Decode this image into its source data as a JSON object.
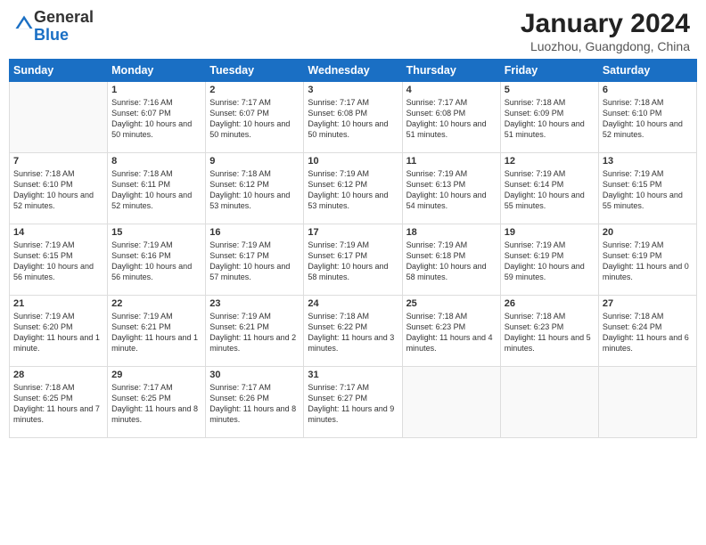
{
  "logo": {
    "general": "General",
    "blue": "Blue"
  },
  "title": "January 2024",
  "subtitle": "Luozhou, Guangdong, China",
  "days_of_week": [
    "Sunday",
    "Monday",
    "Tuesday",
    "Wednesday",
    "Thursday",
    "Friday",
    "Saturday"
  ],
  "weeks": [
    [
      {
        "num": "",
        "info": ""
      },
      {
        "num": "1",
        "info": "Sunrise: 7:16 AM\nSunset: 6:07 PM\nDaylight: 10 hours\nand 50 minutes."
      },
      {
        "num": "2",
        "info": "Sunrise: 7:17 AM\nSunset: 6:07 PM\nDaylight: 10 hours\nand 50 minutes."
      },
      {
        "num": "3",
        "info": "Sunrise: 7:17 AM\nSunset: 6:08 PM\nDaylight: 10 hours\nand 50 minutes."
      },
      {
        "num": "4",
        "info": "Sunrise: 7:17 AM\nSunset: 6:08 PM\nDaylight: 10 hours\nand 51 minutes."
      },
      {
        "num": "5",
        "info": "Sunrise: 7:18 AM\nSunset: 6:09 PM\nDaylight: 10 hours\nand 51 minutes."
      },
      {
        "num": "6",
        "info": "Sunrise: 7:18 AM\nSunset: 6:10 PM\nDaylight: 10 hours\nand 52 minutes."
      }
    ],
    [
      {
        "num": "7",
        "info": "Sunrise: 7:18 AM\nSunset: 6:10 PM\nDaylight: 10 hours\nand 52 minutes."
      },
      {
        "num": "8",
        "info": "Sunrise: 7:18 AM\nSunset: 6:11 PM\nDaylight: 10 hours\nand 52 minutes."
      },
      {
        "num": "9",
        "info": "Sunrise: 7:18 AM\nSunset: 6:12 PM\nDaylight: 10 hours\nand 53 minutes."
      },
      {
        "num": "10",
        "info": "Sunrise: 7:19 AM\nSunset: 6:12 PM\nDaylight: 10 hours\nand 53 minutes."
      },
      {
        "num": "11",
        "info": "Sunrise: 7:19 AM\nSunset: 6:13 PM\nDaylight: 10 hours\nand 54 minutes."
      },
      {
        "num": "12",
        "info": "Sunrise: 7:19 AM\nSunset: 6:14 PM\nDaylight: 10 hours\nand 55 minutes."
      },
      {
        "num": "13",
        "info": "Sunrise: 7:19 AM\nSunset: 6:15 PM\nDaylight: 10 hours\nand 55 minutes."
      }
    ],
    [
      {
        "num": "14",
        "info": "Sunrise: 7:19 AM\nSunset: 6:15 PM\nDaylight: 10 hours\nand 56 minutes."
      },
      {
        "num": "15",
        "info": "Sunrise: 7:19 AM\nSunset: 6:16 PM\nDaylight: 10 hours\nand 56 minutes."
      },
      {
        "num": "16",
        "info": "Sunrise: 7:19 AM\nSunset: 6:17 PM\nDaylight: 10 hours\nand 57 minutes."
      },
      {
        "num": "17",
        "info": "Sunrise: 7:19 AM\nSunset: 6:17 PM\nDaylight: 10 hours\nand 58 minutes."
      },
      {
        "num": "18",
        "info": "Sunrise: 7:19 AM\nSunset: 6:18 PM\nDaylight: 10 hours\nand 58 minutes."
      },
      {
        "num": "19",
        "info": "Sunrise: 7:19 AM\nSunset: 6:19 PM\nDaylight: 10 hours\nand 59 minutes."
      },
      {
        "num": "20",
        "info": "Sunrise: 7:19 AM\nSunset: 6:19 PM\nDaylight: 11 hours\nand 0 minutes."
      }
    ],
    [
      {
        "num": "21",
        "info": "Sunrise: 7:19 AM\nSunset: 6:20 PM\nDaylight: 11 hours\nand 1 minute."
      },
      {
        "num": "22",
        "info": "Sunrise: 7:19 AM\nSunset: 6:21 PM\nDaylight: 11 hours\nand 1 minute."
      },
      {
        "num": "23",
        "info": "Sunrise: 7:19 AM\nSunset: 6:21 PM\nDaylight: 11 hours\nand 2 minutes."
      },
      {
        "num": "24",
        "info": "Sunrise: 7:18 AM\nSunset: 6:22 PM\nDaylight: 11 hours\nand 3 minutes."
      },
      {
        "num": "25",
        "info": "Sunrise: 7:18 AM\nSunset: 6:23 PM\nDaylight: 11 hours\nand 4 minutes."
      },
      {
        "num": "26",
        "info": "Sunrise: 7:18 AM\nSunset: 6:23 PM\nDaylight: 11 hours\nand 5 minutes."
      },
      {
        "num": "27",
        "info": "Sunrise: 7:18 AM\nSunset: 6:24 PM\nDaylight: 11 hours\nand 6 minutes."
      }
    ],
    [
      {
        "num": "28",
        "info": "Sunrise: 7:18 AM\nSunset: 6:25 PM\nDaylight: 11 hours\nand 7 minutes."
      },
      {
        "num": "29",
        "info": "Sunrise: 7:17 AM\nSunset: 6:25 PM\nDaylight: 11 hours\nand 8 minutes."
      },
      {
        "num": "30",
        "info": "Sunrise: 7:17 AM\nSunset: 6:26 PM\nDaylight: 11 hours\nand 8 minutes."
      },
      {
        "num": "31",
        "info": "Sunrise: 7:17 AM\nSunset: 6:27 PM\nDaylight: 11 hours\nand 9 minutes."
      },
      {
        "num": "",
        "info": ""
      },
      {
        "num": "",
        "info": ""
      },
      {
        "num": "",
        "info": ""
      }
    ]
  ]
}
